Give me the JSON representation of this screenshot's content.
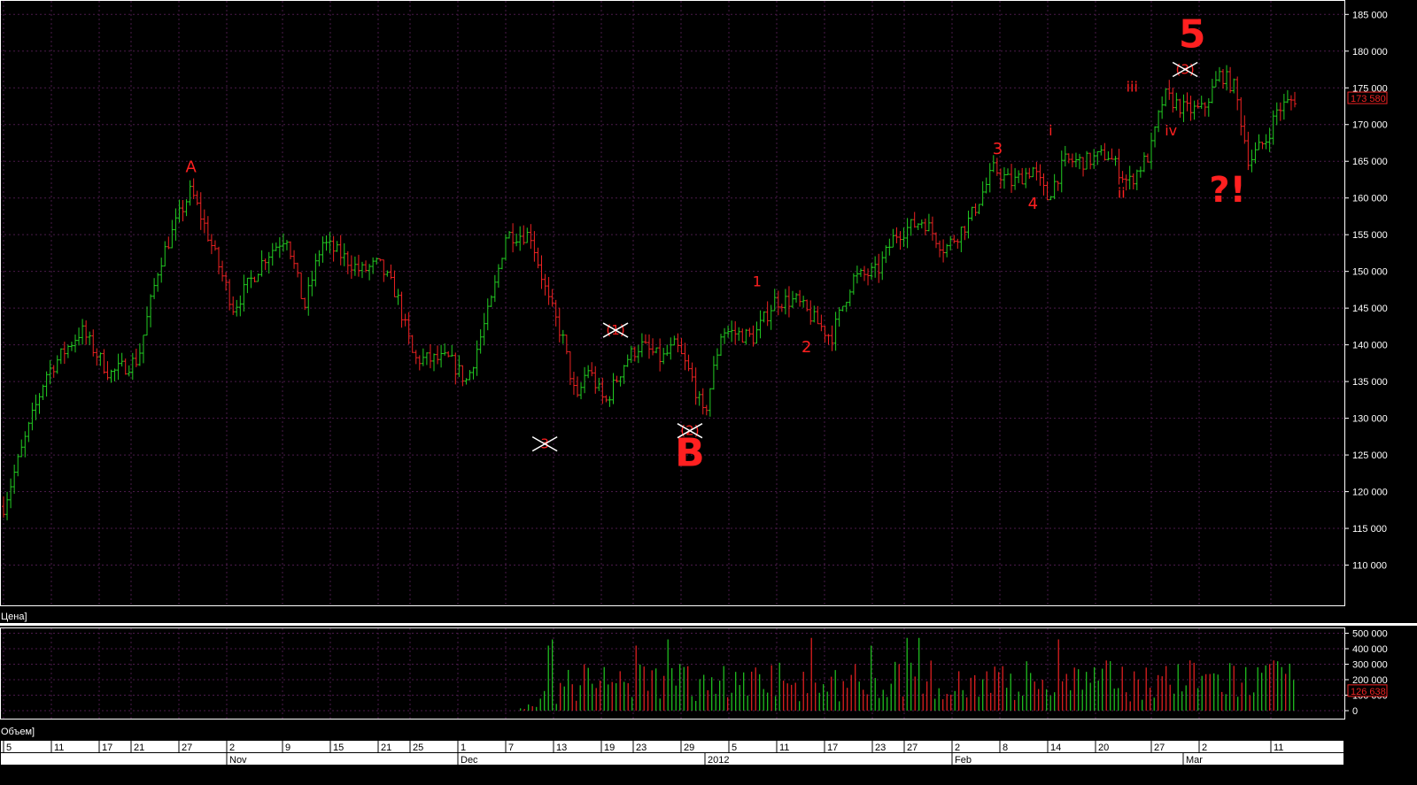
{
  "panels": {
    "price_label": "Цена]",
    "volume_label": "Объем]"
  },
  "colors": {
    "background": "#000000",
    "grid": "#4a1a4a",
    "frame": "#ffffff",
    "up": "#22cc22",
    "down": "#ee2222",
    "annotation": "#ff2020",
    "cross": "#ffffff",
    "last_price_box": "#ee2222"
  },
  "chart_data": [
    {
      "type": "bar",
      "style": "ohlc",
      "panel": "price",
      "title": "",
      "ylim": [
        105000,
        186000
      ],
      "y_ticks": [
        "185 000",
        "180 000",
        "175 000",
        "170 000",
        "165 000",
        "160 000",
        "155 000",
        "150 000",
        "145 000",
        "140 000",
        "135 000",
        "130 000",
        "125 000",
        "120 000",
        "115 000",
        "110 000"
      ],
      "y_tick_values": [
        185000,
        180000,
        175000,
        170000,
        165000,
        160000,
        155000,
        150000,
        145000,
        140000,
        135000,
        130000,
        125000,
        120000,
        115000,
        110000
      ],
      "last_price_label": "173 580",
      "last_price": 173580,
      "grid": true,
      "path_points": [
        [
          0,
          118000
        ],
        [
          12,
          136000
        ],
        [
          22,
          142000
        ],
        [
          30,
          136000
        ],
        [
          38,
          138000
        ],
        [
          44,
          151000
        ],
        [
          50,
          158000
        ],
        [
          53,
          161000
        ],
        [
          57,
          156000
        ],
        [
          65,
          145000
        ],
        [
          74,
          152000
        ],
        [
          80,
          155000
        ],
        [
          85,
          145000
        ],
        [
          90,
          154000
        ],
        [
          96,
          152000
        ],
        [
          101,
          150000
        ],
        [
          106,
          151000
        ],
        [
          111,
          147000
        ],
        [
          116,
          138000
        ],
        [
          126,
          138000
        ],
        [
          131,
          135000
        ],
        [
          138,
          146000
        ],
        [
          142,
          155000
        ],
        [
          149,
          155000
        ],
        [
          154,
          146000
        ],
        [
          158,
          141000
        ],
        [
          162,
          132000
        ],
        [
          165,
          137000
        ],
        [
          170,
          132000
        ],
        [
          176,
          138000
        ],
        [
          180,
          140000
        ],
        [
          186,
          138000
        ],
        [
          190,
          140000
        ],
        [
          195,
          135000
        ],
        [
          198,
          130000
        ],
        [
          203,
          142000
        ],
        [
          212,
          141000
        ],
        [
          218,
          146000
        ],
        [
          224,
          146000
        ],
        [
          230,
          143000
        ],
        [
          234,
          141000
        ],
        [
          240,
          149000
        ],
        [
          247,
          150000
        ],
        [
          252,
          155000
        ],
        [
          260,
          157000
        ],
        [
          266,
          153000
        ],
        [
          273,
          157000
        ],
        [
          280,
          164000
        ],
        [
          285,
          162000
        ],
        [
          291,
          164000
        ],
        [
          295,
          160000
        ],
        [
          300,
          165000
        ],
        [
          306,
          165000
        ],
        [
          312,
          166000
        ],
        [
          318,
          162000
        ],
        [
          324,
          166000
        ],
        [
          328,
          174000
        ],
        [
          334,
          172000
        ],
        [
          339,
          172000
        ],
        [
          344,
          177000
        ],
        [
          348,
          175000
        ],
        [
          352,
          165000
        ],
        [
          357,
          168000
        ],
        [
          360,
          172000
        ],
        [
          365,
          173580
        ]
      ],
      "annotations": [
        {
          "text": "A",
          "x": 53,
          "y": 163500,
          "size": "medium"
        },
        {
          "text": "1",
          "x": 213,
          "y": 148000,
          "size": "small"
        },
        {
          "text": "2",
          "x": 227,
          "y": 139000,
          "size": "medium"
        },
        {
          "text": "3",
          "x": 281,
          "y": 166000,
          "size": "medium"
        },
        {
          "text": "4",
          "x": 291,
          "y": 158500,
          "size": "medium"
        },
        {
          "text": "i",
          "x": 296,
          "y": 168500,
          "size": "small"
        },
        {
          "text": "ii",
          "x": 316,
          "y": 160000,
          "size": "small"
        },
        {
          "text": "iii",
          "x": 319,
          "y": 174500,
          "size": "small"
        },
        {
          "text": "iv",
          "x": 330,
          "y": 168500,
          "size": "small"
        },
        {
          "text": "B",
          "x": 194,
          "y": 123500,
          "size": "huge"
        },
        {
          "text": "5",
          "x": 336,
          "y": 180500,
          "size": "huge"
        },
        {
          "text": "?!",
          "x": 346,
          "y": 159500,
          "size": "big"
        }
      ],
      "crossed_out_labels": [
        {
          "text": "3",
          "x": 153,
          "y": 126500
        },
        {
          "text": "(1)",
          "x": 173,
          "y": 142000
        },
        {
          "text": "(2)",
          "x": 194,
          "y": 128300
        },
        {
          "text": "(3)",
          "x": 334,
          "y": 177500
        }
      ]
    },
    {
      "type": "bar",
      "panel": "volume",
      "title": "",
      "ylim": [
        -40000,
        520000
      ],
      "y_ticks": [
        "500 000",
        "400 000",
        "300 000",
        "200 000",
        "100 000",
        "0"
      ],
      "y_tick_values": [
        500000,
        400000,
        300000,
        200000,
        100000,
        0
      ],
      "last_volume_label": "126 638",
      "last_volume": 126638,
      "data_starts_day": 145,
      "typical_range": [
        60000,
        330000
      ],
      "peaks": [
        420000,
        460000,
        470000
      ]
    }
  ],
  "x_axis": {
    "day_labels": [
      {
        "label": "5",
        "d": 0
      },
      {
        "label": "11",
        "d": 6
      },
      {
        "label": "17",
        "d": 12
      },
      {
        "label": "21",
        "d": 16
      },
      {
        "label": "27",
        "d": 22
      },
      {
        "label": "2",
        "d": 28
      },
      {
        "label": "9",
        "d": 35
      },
      {
        "label": "15",
        "d": 41
      },
      {
        "label": "21",
        "d": 47
      },
      {
        "label": "25",
        "d": 51
      },
      {
        "label": "1",
        "d": 57
      },
      {
        "label": "7",
        "d": 63
      },
      {
        "label": "13",
        "d": 69
      },
      {
        "label": "19",
        "d": 75
      },
      {
        "label": "23",
        "d": 79
      },
      {
        "label": "29",
        "d": 85
      },
      {
        "label": "5",
        "d": 91
      },
      {
        "label": "11",
        "d": 97
      },
      {
        "label": "17",
        "d": 103
      },
      {
        "label": "23",
        "d": 109
      },
      {
        "label": "27",
        "d": 113
      },
      {
        "label": "2",
        "d": 119
      },
      {
        "label": "8",
        "d": 125
      },
      {
        "label": "14",
        "d": 131
      },
      {
        "label": "20",
        "d": 137
      },
      {
        "label": "27",
        "d": 144
      },
      {
        "label": "2",
        "d": 150
      },
      {
        "label": "11",
        "d": 159
      }
    ],
    "month_labels": [
      {
        "label": "Nov",
        "d": 28
      },
      {
        "label": "Dec",
        "d": 57
      },
      {
        "label": "2012",
        "d": 88
      },
      {
        "label": "Feb",
        "d": 119
      },
      {
        "label": "Mar",
        "d": 148
      }
    ]
  }
}
